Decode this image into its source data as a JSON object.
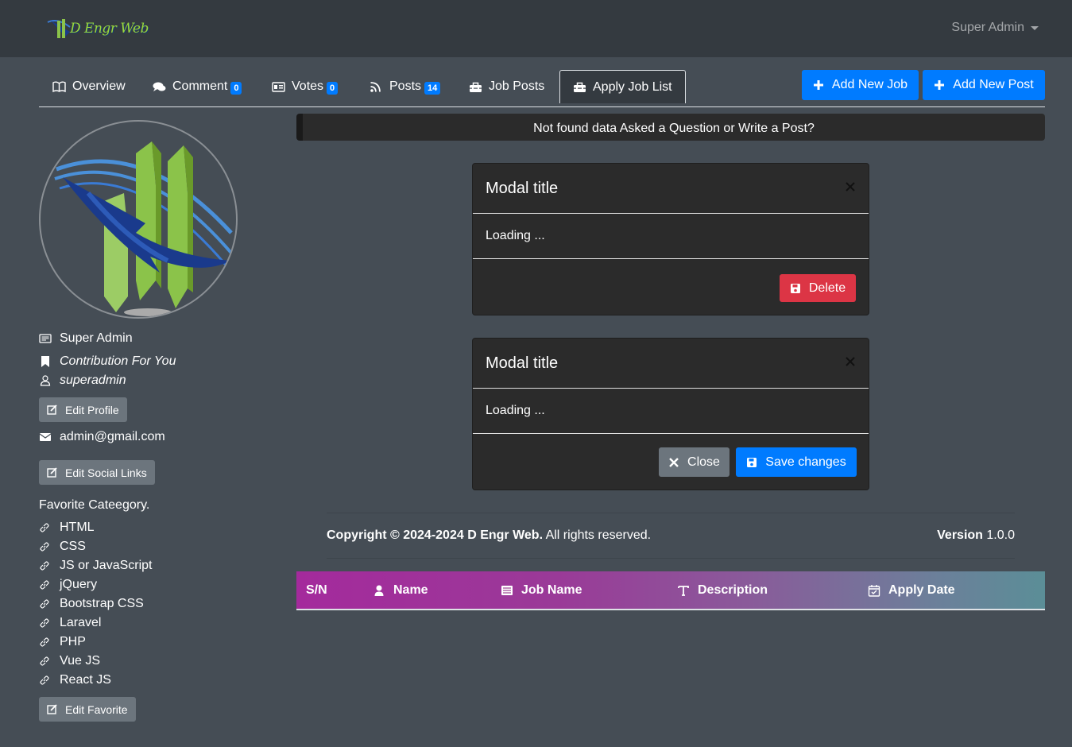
{
  "navbar": {
    "brand": "D Engr Web",
    "user_menu": "Super Admin"
  },
  "tabs": [
    {
      "label": "Overview",
      "icon": "book-icon"
    },
    {
      "label": "Comment",
      "icon": "comments-icon",
      "badge": "0"
    },
    {
      "label": "Votes",
      "icon": "id-card-icon",
      "badge": "0"
    },
    {
      "label": "Posts",
      "icon": "rss-icon",
      "badge": "14"
    },
    {
      "label": "Job Posts",
      "icon": "toolbox-icon"
    },
    {
      "label": "Apply Job List",
      "icon": "toolbox-icon",
      "active": true
    }
  ],
  "actions": {
    "add_job": "Add New Job",
    "add_post": "Add New Post"
  },
  "profile": {
    "name": "Super Admin",
    "tagline": "Contribution For You",
    "username": "superadmin",
    "edit_profile": "Edit Profile",
    "email": "admin@gmail.com",
    "edit_social": "Edit Social Links",
    "favorite_title": "Favorite Cateegory.",
    "favorites": [
      "HTML",
      "CSS",
      "JS or JavaScript",
      "jQuery",
      "Bootstrap CSS",
      "Laravel",
      "PHP",
      "Vue JS",
      "React JS"
    ],
    "edit_favorite": "Edit Favorite"
  },
  "alert": "Not found data Asked a Question or Write a Post?",
  "modal_delete": {
    "title": "Modal title",
    "body": "Loading ...",
    "delete": "Delete"
  },
  "modal_save": {
    "title": "Modal title",
    "body": "Loading ...",
    "close": "Close",
    "save": "Save changes"
  },
  "footer": {
    "copyright_bold": "Copyright © 2024-2024 D Engr Web.",
    "copyright_rest": "All rights reserved.",
    "version_label": "Version",
    "version": "1.0.0"
  },
  "table": {
    "columns": [
      "S/N",
      "Name",
      "Job Name",
      "Description",
      "Apply Date"
    ]
  },
  "colors": {
    "primary": "#007bff",
    "danger": "#dc3545",
    "secondary": "#6c757d",
    "navbar": "#343a40",
    "page": "#454d55"
  }
}
